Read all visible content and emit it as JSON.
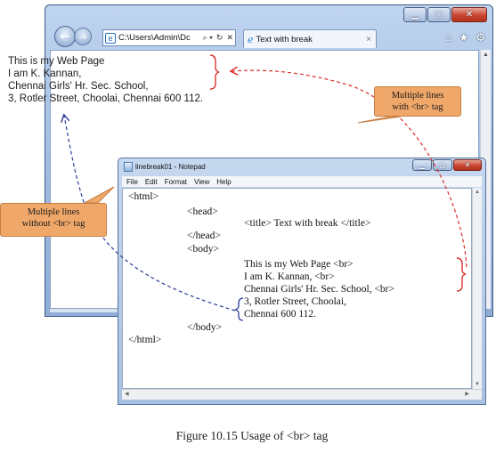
{
  "browser": {
    "address": "C:\\Users\\Admin\\Dc",
    "address_controls": [
      "⌕ ▾",
      "↻",
      "✕"
    ],
    "tab_title": "Text with break",
    "tab_close": "×",
    "window_buttons": [
      "▁",
      "▢",
      "✕"
    ],
    "toolbar_icons": [
      "⌂",
      "★",
      "⚙"
    ],
    "content_lines": [
      "This is my Web Page",
      "I am K. Kannan,",
      "Chennai Girls' Hr. Sec. School,",
      "3, Rotler Street, Choolai, Chennai 600 112."
    ]
  },
  "notepad": {
    "title": "linebreak01 - Notepad",
    "menu": [
      "File",
      "Edit",
      "Format",
      "View",
      "Help"
    ],
    "code_lines": [
      "<html>",
      "<head>",
      "<title> Text with break </title>",
      "</head>",
      "<body>",
      "This is my Web Page <br>",
      "I am K. Kannan, <br>",
      "Chennai Girls' Hr. Sec. School, <br>",
      "3, Rotler Street, Choolai,",
      "Chennai 600 112.",
      "</body>",
      "</html>"
    ]
  },
  "callouts": {
    "with_br": [
      "Multiple lines",
      "with <br> tag"
    ],
    "without_br": [
      "Multiple lines",
      "without <br> tag"
    ]
  },
  "caption": "Figure 10.15 Usage of <br> tag",
  "colors": {
    "callout_fill": "#f0a86a",
    "red_dashed": "#d9312b",
    "blue_dashed": "#2f3f9a"
  }
}
